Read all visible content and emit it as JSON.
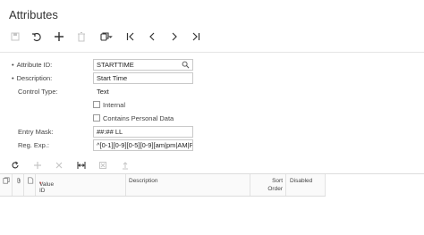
{
  "page": {
    "title": "Attributes"
  },
  "toolbar": {
    "icons": [
      "save-icon",
      "undo-icon",
      "add-icon",
      "delete-icon",
      "copy-icon",
      "chevron-down-icon",
      "first-icon",
      "previous-icon",
      "next-icon",
      "last-icon"
    ]
  },
  "form": {
    "attribute_id": {
      "label": "Attribute ID:",
      "value": "STARTTIME",
      "required": true
    },
    "description": {
      "label": "Description:",
      "value": "Start Time",
      "required": true
    },
    "control_type": {
      "label": "Control Type:",
      "value": "Text"
    },
    "internal": {
      "label": "Internal",
      "checked": false
    },
    "personal_data": {
      "label": "Contains Personal Data",
      "checked": false
    },
    "entry_mask": {
      "label": "Entry Mask:",
      "value": "##:## LL"
    },
    "reg_exp": {
      "label": "Reg. Exp.:",
      "value": "^[0-1][0-9][0-5][0-9][am|pm|AM|PM]"
    }
  },
  "grid": {
    "toolbar_icons": [
      "refresh-icon",
      "add-row-icon",
      "delete-row-icon",
      "fit-columns-icon",
      "export-excel-icon",
      "upload-icon"
    ],
    "columns": {
      "value_id": "Value ID",
      "description": "Description",
      "sort_order_line1": "Sort",
      "sort_order_line2": "Order",
      "disabled": "Disabled"
    }
  }
}
